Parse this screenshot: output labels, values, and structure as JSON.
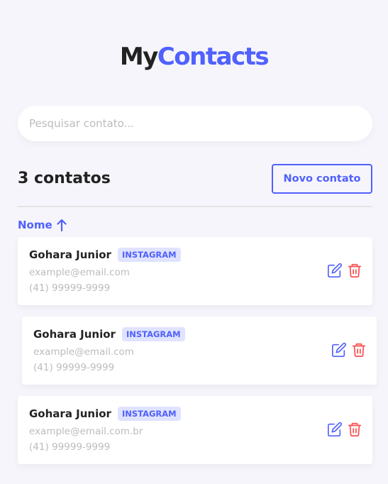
{
  "header": {
    "logo_part1": "My",
    "logo_part2": "Contacts"
  },
  "search": {
    "placeholder": "Pesquisar contato...",
    "value": ""
  },
  "toolbar": {
    "count_label": "3 contatos",
    "new_button": "Novo contato"
  },
  "sort": {
    "label": "Nome",
    "direction": "ascending"
  },
  "colors": {
    "primary": "#5061fc",
    "danger": "#fc5050",
    "background": "#f6f5fc",
    "tag_bg": "#e0e3ff"
  },
  "contacts": [
    {
      "name": "Gohara Junior",
      "tag": "INSTAGRAM",
      "email": "example@email.com",
      "phone": "(41) 99999-9999"
    },
    {
      "name": "Gohara Junior",
      "tag": "INSTAGRAM",
      "email": "example@email.com",
      "phone": "(41) 99999-9999"
    },
    {
      "name": "Gohara Junior",
      "tag": "INSTAGRAM",
      "email": "example@email.com.br",
      "phone": "(41) 99999-9999"
    }
  ],
  "icons": {
    "edit": "edit-icon",
    "delete": "trash-icon",
    "sort": "arrow-up-icon"
  }
}
